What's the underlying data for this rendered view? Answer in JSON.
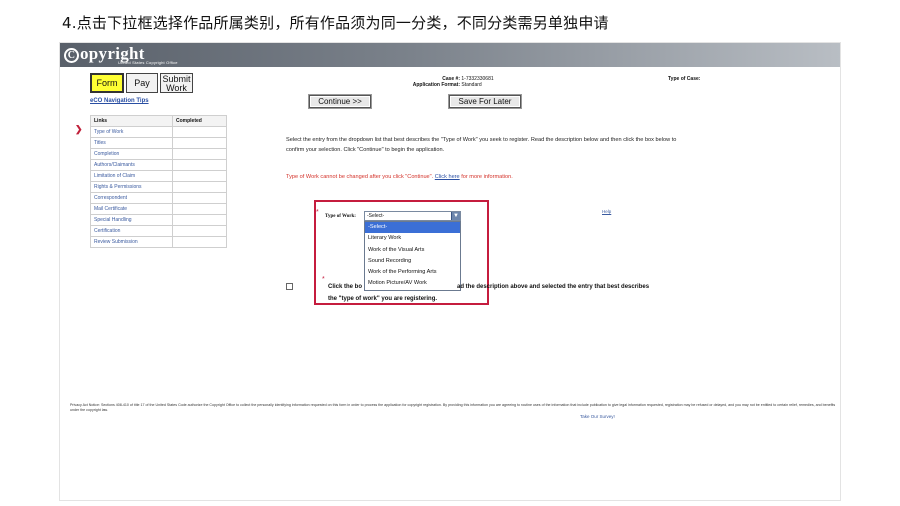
{
  "slide_title": "4.点击下拉框选择作品所属类别，所有作品须为同一分类，不同分类需另单独申请",
  "logo": {
    "text": "opyright",
    "mark": "C",
    "subtitle": "United States Copyright Office"
  },
  "tabs": {
    "form": "Form",
    "pay": "Pay",
    "submit": "Submit Work"
  },
  "nav_tips": "eCO Navigation Tips",
  "links_table": {
    "headers": [
      "Links",
      "Completed"
    ],
    "rows": [
      {
        "label": "Type of Work",
        "completed": ""
      },
      {
        "label": "Titles",
        "completed": ""
      },
      {
        "label": "Completion",
        "completed": ""
      },
      {
        "label": "Authors/Claimants",
        "completed": ""
      },
      {
        "label": "Limitation of Claim",
        "completed": ""
      },
      {
        "label": "Rights & Permissions",
        "completed": ""
      },
      {
        "label": "Correspondent",
        "completed": ""
      },
      {
        "label": "Mail Certificate",
        "completed": ""
      },
      {
        "label": "Special Handling",
        "completed": ""
      },
      {
        "label": "Certification",
        "completed": ""
      },
      {
        "label": "Review Submission",
        "completed": ""
      }
    ]
  },
  "case": {
    "case_label": "Case #:",
    "case_value": "1-7332330681",
    "format_label": "Application Format:",
    "format_value": "Standard",
    "type_of_case_label": "Type of Case:"
  },
  "buttons": {
    "continue": "Continue >>",
    "save_for_later": "Save For Later"
  },
  "instructions": "Select the entry from the dropdown list that best describes the \"Type of Work\" you seek to register. Read the description below and then click the box below to confirm your selection. Click \"Continue\" to begin the application.",
  "warning": {
    "text": "Type of Work cannot be changed after you click \"Continue\".",
    "link": "Click here",
    "suffix": "for more information."
  },
  "type_of_work": {
    "label": "Type of Work:",
    "selected": "-Select-",
    "options": [
      "-Select-",
      "Literary Work",
      "Work of the Visual Arts",
      "Sound Recording",
      "Work of the Performing Arts",
      "Motion Picture/AV Work"
    ]
  },
  "help_link": "Help",
  "confirm": {
    "part1": "Click the bo",
    "part2": "ad the description above and selected the entry that best describes",
    "part3": "the \"type of work\" you are registering."
  },
  "privacy_notice": "Privacy Act Notice: Sections 408-410 of title 17 of the United States Code authorize the Copyright Office to collect the personally identifying information requested on this form in order to process the application for copyright registration. By providing this information you are agreeing to routine uses of the information that include publication to give legal information requested, registration may be refused or delayed, and you may not be entitled to certain relief, remedies, and benefits under the copyright law.",
  "survey_link": "Take Our Survey!",
  "colors": {
    "accent_red": "#c51c3e",
    "link_blue": "#2a4fa3",
    "tab_yellow": "#ffff33",
    "select_highlight": "#3b6fd6"
  }
}
